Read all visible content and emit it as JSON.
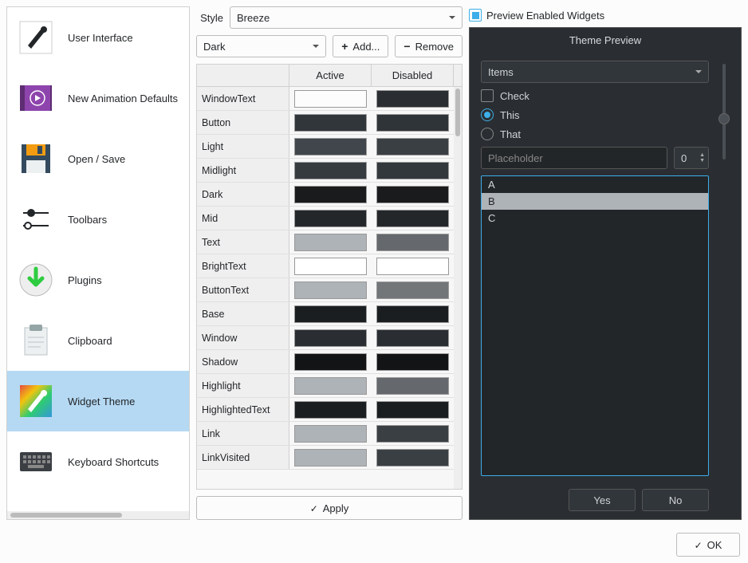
{
  "sidebar": {
    "items": [
      {
        "label": "User Interface",
        "icon": "brush"
      },
      {
        "label": "New Animation Defaults",
        "icon": "play"
      },
      {
        "label": "Open / Save",
        "icon": "disk"
      },
      {
        "label": "Toolbars",
        "icon": "sliders"
      },
      {
        "label": "Plugins",
        "icon": "download"
      },
      {
        "label": "Clipboard",
        "icon": "clipboard"
      },
      {
        "label": "Widget Theme",
        "icon": "palette",
        "selected": true
      },
      {
        "label": "Keyboard Shortcuts",
        "icon": "keyboard"
      }
    ]
  },
  "center": {
    "style_label": "Style",
    "style_value": "Breeze",
    "palette_value": "Dark",
    "add_label": "Add...",
    "remove_label": "Remove",
    "col_active": "Active",
    "col_disabled": "Disabled",
    "apply_label": "Apply",
    "rows": [
      {
        "role": "WindowText",
        "active": "#fcfcfc",
        "disabled": "#2a2e32"
      },
      {
        "role": "Button",
        "active": "#31363b",
        "disabled": "#2f3438"
      },
      {
        "role": "Light",
        "active": "#40464c",
        "disabled": "#3a3f44"
      },
      {
        "role": "Midlight",
        "active": "#363b40",
        "disabled": "#33383d"
      },
      {
        "role": "Dark",
        "active": "#191b1d",
        "disabled": "#191b1d"
      },
      {
        "role": "Mid",
        "active": "#24272a",
        "disabled": "#24272a"
      },
      {
        "role": "Text",
        "active": "#aeb3b8",
        "disabled": "#65696d"
      },
      {
        "role": "BrightText",
        "active": "#ffffff",
        "disabled": "#ffffff"
      },
      {
        "role": "ButtonText",
        "active": "#aeb3b8",
        "disabled": "#727679"
      },
      {
        "role": "Base",
        "active": "#1b1e20",
        "disabled": "#1b1e20"
      },
      {
        "role": "Window",
        "active": "#2a2e32",
        "disabled": "#2a2e32"
      },
      {
        "role": "Shadow",
        "active": "#121415",
        "disabled": "#121415"
      },
      {
        "role": "Highlight",
        "active": "#aeb3b8",
        "disabled": "#65686c"
      },
      {
        "role": "HighlightedText",
        "active": "#1b1e20",
        "disabled": "#1b1e20"
      },
      {
        "role": "Link",
        "active": "#aeb3b8",
        "disabled": "#3a3f44"
      },
      {
        "role": "LinkVisited",
        "active": "#aeb3b8",
        "disabled": "#3a3f44"
      }
    ]
  },
  "preview": {
    "checkbox_label": "Preview Enabled Widgets",
    "title": "Theme Preview",
    "combo": "Items",
    "check_label": "Check",
    "radio_this": "This",
    "radio_that": "That",
    "placeholder": "Placeholder",
    "spin_value": "0",
    "list": [
      "A",
      "B",
      "C"
    ],
    "yes": "Yes",
    "no": "No"
  },
  "footer": {
    "ok": "OK"
  }
}
